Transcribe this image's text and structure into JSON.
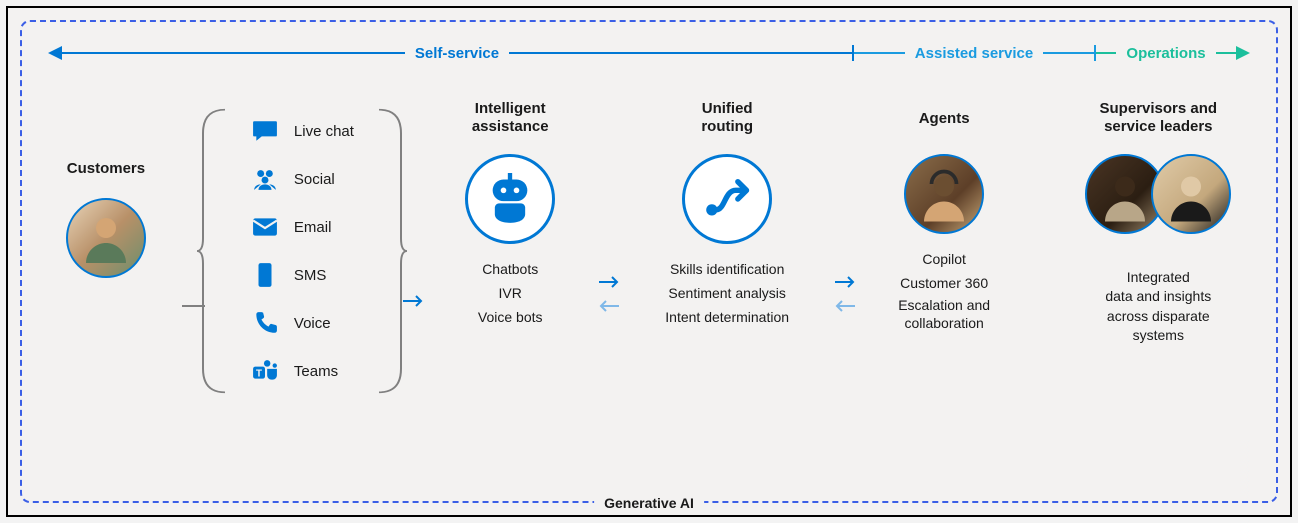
{
  "sections": {
    "self_service": "Self-service",
    "assisted_service": "Assisted service",
    "operations": "Operations"
  },
  "customers": {
    "title": "Customers"
  },
  "channels": [
    {
      "icon": "chat-bubble-icon",
      "label": "Live chat"
    },
    {
      "icon": "people-icon",
      "label": "Social"
    },
    {
      "icon": "envelope-icon",
      "label": "Email"
    },
    {
      "icon": "phone-device-icon",
      "label": "SMS"
    },
    {
      "icon": "telephone-icon",
      "label": "Voice"
    },
    {
      "icon": "teams-icon",
      "label": "Teams"
    }
  ],
  "intelligent": {
    "title": "Intelligent\nassistance",
    "items": [
      "Chatbots",
      "IVR",
      "Voice bots"
    ]
  },
  "routing": {
    "title": "Unified\nrouting",
    "items": [
      "Skills identification",
      "Sentiment analysis",
      "Intent determination"
    ]
  },
  "agents": {
    "title": "Agents",
    "items": [
      "Copilot",
      "Customer 360",
      "Escalation and collaboration"
    ]
  },
  "supervisors": {
    "title": "Supervisors and\nservice leaders",
    "items": [
      "Integrated\ndata and insights\nacross disparate\nsystems"
    ]
  },
  "footer": "Generative AI"
}
